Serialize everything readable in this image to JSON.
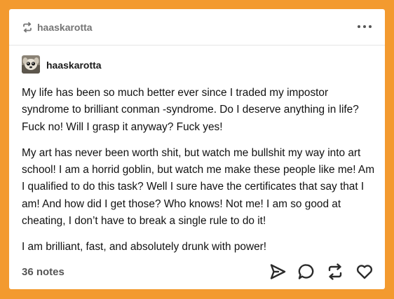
{
  "post": {
    "reblogged_from": "haaskarotta",
    "author": "haaskarotta",
    "paragraphs": [
      "My life has been so much better ever since I traded my impostor syndrome to brilliant conman -syndrome. Do I deserve anything in life? Fuck no! Will I grasp it anyway? Fuck yes!",
      " My art has never been worth shit, but watch me bullshit my way into art school! I am a horrid goblin, but watch me make these people like me! Am I qualified to do this task? Well I sure have the certificates that say that I am! And how did I get those? Who knows! Not me! I am so good at cheating, I don’t have to break a single rule to do it!",
      " I am brilliant, fast, and absolutely drunk with power!"
    ],
    "notes": "36 notes"
  },
  "icons": {
    "reblog_header": "reblog-icon",
    "menu": "more-options-icon",
    "share": "share-icon",
    "reply": "reply-icon",
    "reblog": "reblog-icon",
    "like": "heart-icon"
  },
  "colors": {
    "background": "#f39a2f",
    "card": "#ffffff",
    "muted_text": "#757575",
    "body_text": "#111111"
  }
}
